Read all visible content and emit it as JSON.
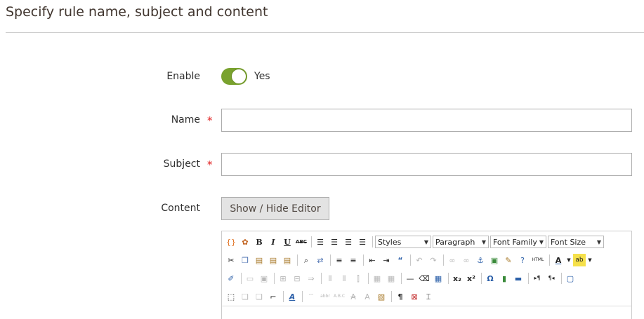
{
  "section": {
    "title": "Specify rule name, subject and content"
  },
  "form": {
    "enable_label": "Enable",
    "enable_state": "Yes",
    "enable_on": true,
    "name_label": "Name",
    "name_value": "",
    "subject_label": "Subject",
    "subject_value": "",
    "content_label": "Content",
    "required_mark": "*",
    "toggle_editor_label": "Show / Hide Editor"
  },
  "editor": {
    "styles_select": "Styles",
    "format_select": "Paragraph",
    "font_family_select": "Font Family",
    "font_size_select": "Font Size",
    "bold": "B",
    "italic": "I",
    "underline": "U",
    "strike": "ABC",
    "html": "HTML",
    "subscript": "x₂",
    "superscript": "x²",
    "omega": "Ω",
    "pilcrow": "¶",
    "font_color": "A",
    "ltr": "▸¶",
    "rtl": "¶◂"
  },
  "colors": {
    "toggle_on": "#79a22e",
    "required": "#e22626",
    "button_bg": "#e3e3e3"
  }
}
